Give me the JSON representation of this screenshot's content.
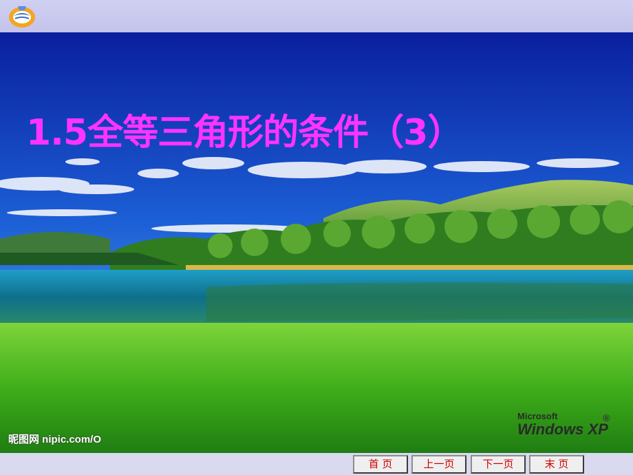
{
  "slide": {
    "title": "1.5全等三角形的条件（3）"
  },
  "watermark": {
    "text": "昵图网 nipic.com/O"
  },
  "os_logo": {
    "line1": "Microsoft",
    "line2": "Windows XP",
    "mark": "®"
  },
  "nav": {
    "first": "首 页",
    "prev": "上一页",
    "next": "下一页",
    "last": "末 页"
  },
  "colors": {
    "title": "#ff33ff",
    "nav_text": "#d00000",
    "topbar": "#c8c8ee"
  },
  "icons": [
    "book-logo-icon"
  ]
}
